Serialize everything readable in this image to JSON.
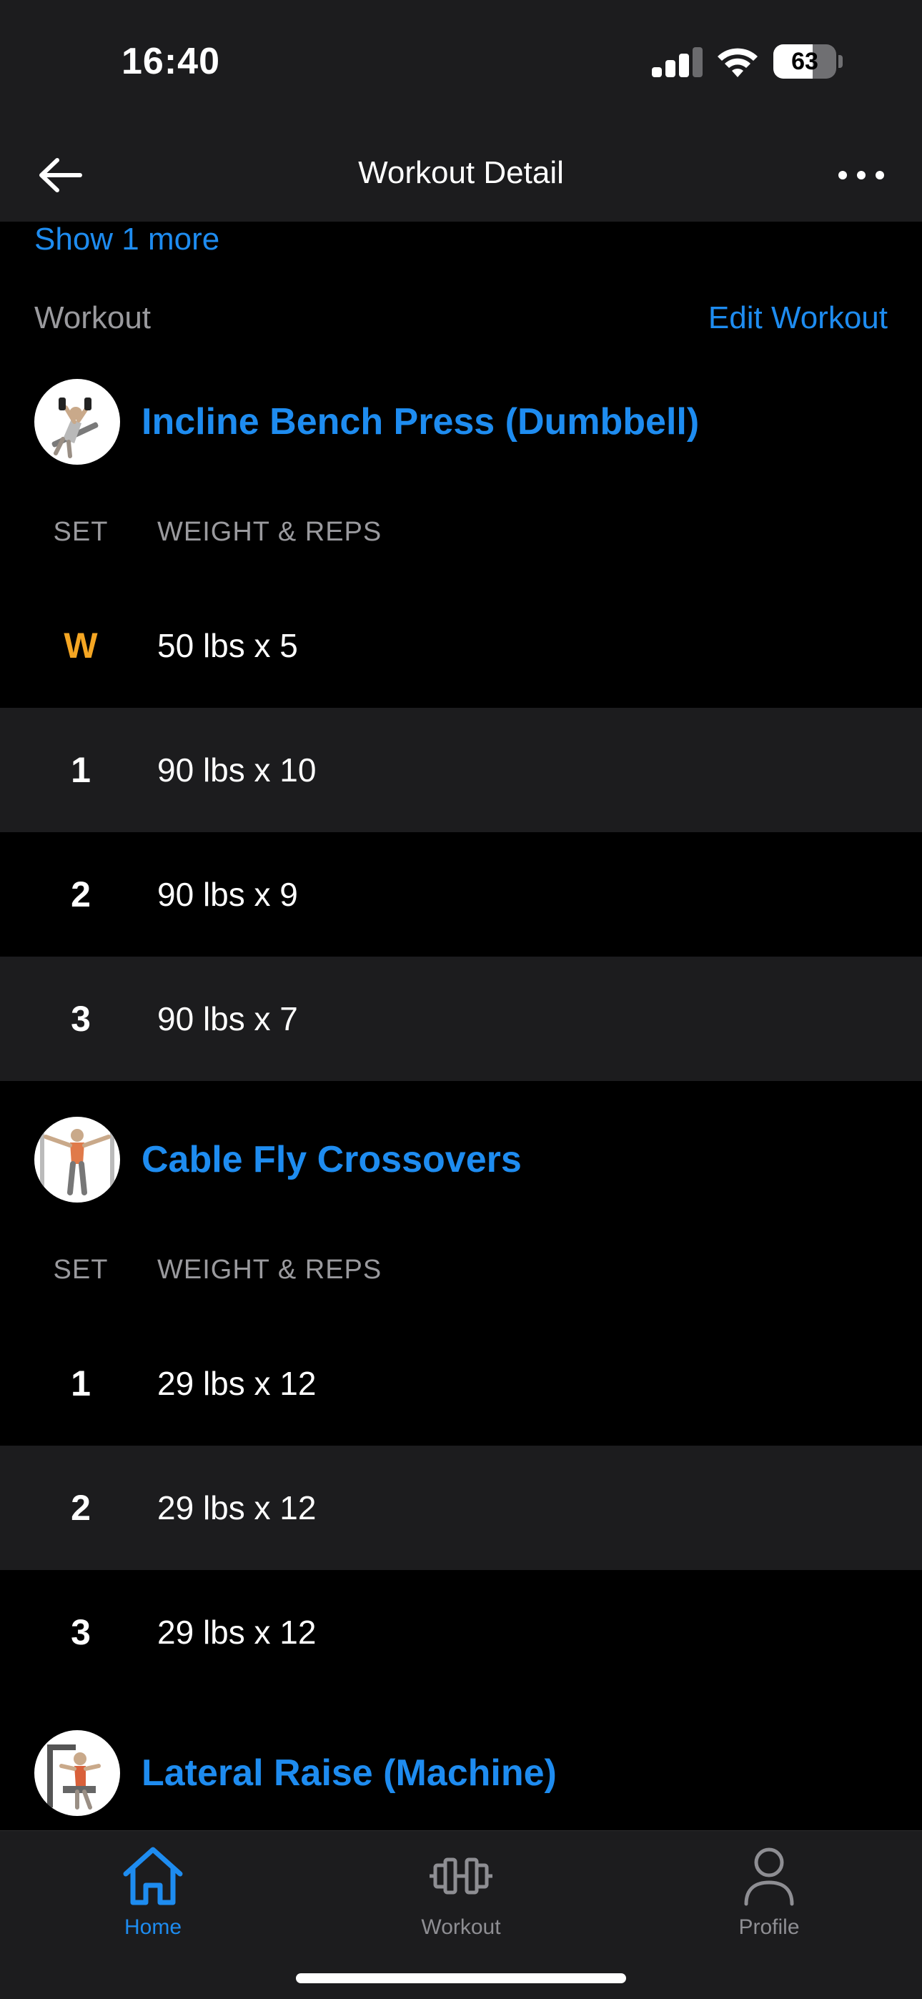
{
  "status_bar": {
    "time": "16:40",
    "battery_percent": "63",
    "battery_level": 0.63,
    "signal_bars_active": 3,
    "signal_bars_total": 4
  },
  "nav": {
    "title": "Workout Detail",
    "back_icon": "arrow-left-icon",
    "more_icon": "more-dots-icon"
  },
  "show_more_label": "Show 1 more",
  "workout_section": {
    "label": "Workout",
    "edit_label": "Edit Workout"
  },
  "columns": {
    "set": "SET",
    "weight_reps": "WEIGHT & REPS"
  },
  "exercises": [
    {
      "name": "Incline Bench Press (Dumbbell)",
      "sets": [
        {
          "set": "W",
          "value": "50 lbs x 5",
          "warmup": true
        },
        {
          "set": "1",
          "value": "90 lbs x 10"
        },
        {
          "set": "2",
          "value": "90 lbs x 9"
        },
        {
          "set": "3",
          "value": "90 lbs x 7"
        }
      ]
    },
    {
      "name": "Cable Fly Crossovers",
      "sets": [
        {
          "set": "1",
          "value": "29 lbs x 12"
        },
        {
          "set": "2",
          "value": "29 lbs x 12"
        },
        {
          "set": "3",
          "value": "29 lbs x 12"
        }
      ]
    },
    {
      "name": "Lateral Raise (Machine)",
      "sets": []
    }
  ],
  "tab_bar": {
    "tabs": [
      {
        "label": "Home",
        "icon": "home-icon",
        "active": true
      },
      {
        "label": "Workout",
        "icon": "dumbbell-icon",
        "active": false
      },
      {
        "label": "Profile",
        "icon": "profile-icon",
        "active": false
      }
    ]
  },
  "colors": {
    "accent": "#1e8cf0",
    "warmup": "#f5a623",
    "surface": "#1c1c1e",
    "background": "#000000"
  }
}
